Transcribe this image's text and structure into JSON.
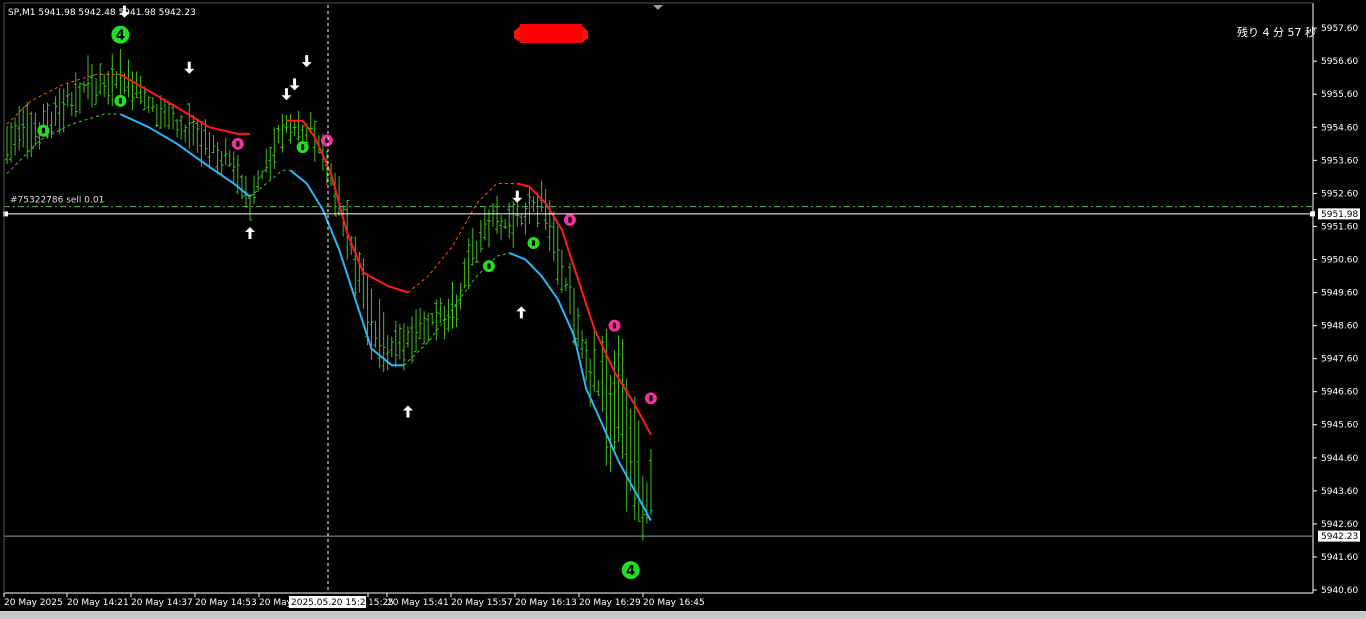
{
  "window": {
    "symbol_info": "SP,M1  5941.98 5942.48 5941.98 5942.23",
    "countdown": "残り 4 分 57 秒",
    "order_label": "#75322786 sell 0.01",
    "crosshair_time": "2025.05.20 15:26"
  },
  "colors": {
    "background": "#000000",
    "bars": "#3fbf1f",
    "upper_line": "#ff1a1a",
    "lower_line": "#29b6f6",
    "order_line": "#33cc33",
    "circle_green": "#22dd22",
    "circle_pink": "#ee3399",
    "arrows": "#ffffff"
  },
  "chart_data": {
    "type": "line",
    "xlabel": "",
    "ylabel": "",
    "ylim": [
      5940.6,
      5958.3
    ],
    "yticks": [
      "5957.60",
      "5956.60",
      "5955.60",
      "5954.60",
      "5953.60",
      "5952.60",
      "5951.60",
      "5950.60",
      "5949.60",
      "5948.60",
      "5947.60",
      "5946.60",
      "5945.60",
      "5944.60",
      "5943.60",
      "5942.60",
      "5941.60",
      "5940.60"
    ],
    "xticks": [
      "20 May 2025",
      "20 May 14:21",
      "20 May 14:37",
      "20 May 14:53",
      "20 May",
      "15:25",
      "20 May 15:41",
      "20 May 15:57",
      "20 May 16:13",
      "20 May 16:29",
      "20 May 16:45"
    ],
    "current_price": "5942.23",
    "order_price": "5951.98",
    "order_level": 5952.2,
    "bar_count": 160,
    "bar_ranges_keypoints": [
      [
        0,
        5953.0,
        5955.2
      ],
      [
        10,
        5954.0,
        5955.6
      ],
      [
        20,
        5955.0,
        5956.8
      ],
      [
        28,
        5955.3,
        5957.0
      ],
      [
        35,
        5954.8,
        5955.9
      ],
      [
        45,
        5953.6,
        5955.4
      ],
      [
        55,
        5952.8,
        5954.3
      ],
      [
        60,
        5951.7,
        5953.0
      ],
      [
        68,
        5953.6,
        5955.5
      ],
      [
        75,
        5953.8,
        5955.3
      ],
      [
        80,
        5952.4,
        5954.0
      ],
      [
        90,
        5947.5,
        5950.0
      ],
      [
        95,
        5946.8,
        5948.9
      ],
      [
        102,
        5947.6,
        5949.4
      ],
      [
        110,
        5948.2,
        5950.0
      ],
      [
        118,
        5951.0,
        5952.5
      ],
      [
        125,
        5950.6,
        5952.6
      ],
      [
        132,
        5951.7,
        5953.3
      ],
      [
        138,
        5948.8,
        5951.0
      ],
      [
        145,
        5945.0,
        5948.6
      ],
      [
        150,
        5943.6,
        5949.2
      ],
      [
        155,
        5942.1,
        5946.7
      ],
      [
        159,
        5941.2,
        5945.0
      ]
    ],
    "series": [
      {
        "style": "solid",
        "color": "#ff1a1a",
        "points": [
          [
            28,
            5956.2
          ],
          [
            35,
            5955.7
          ],
          [
            42,
            5955.2
          ],
          [
            50,
            5954.6
          ],
          [
            57,
            5954.4
          ],
          [
            60,
            5954.4
          ]
        ]
      },
      {
        "style": "solid",
        "color": "#ff1a1a",
        "points": [
          [
            69,
            5954.8
          ],
          [
            73,
            5954.8
          ],
          [
            76,
            5954.3
          ],
          [
            80,
            5953.2
          ],
          [
            84,
            5951.4
          ],
          [
            88,
            5950.2
          ],
          [
            94,
            5949.8
          ],
          [
            99,
            5949.6
          ]
        ]
      },
      {
        "style": "solid",
        "color": "#ff1a1a",
        "points": [
          [
            126,
            5952.9
          ],
          [
            129,
            5952.8
          ],
          [
            133,
            5952.3
          ],
          [
            137,
            5951.5
          ],
          [
            141,
            5950.0
          ],
          [
            145,
            5948.5
          ],
          [
            150,
            5947.2
          ],
          [
            155,
            5946.2
          ],
          [
            159,
            5945.3
          ]
        ]
      },
      {
        "style": "dashed",
        "color": "#ff5522",
        "points": [
          [
            0,
            5954.7
          ],
          [
            6,
            5955.4
          ],
          [
            14,
            5955.9
          ],
          [
            22,
            5956.2
          ],
          [
            28,
            5956.2
          ]
        ]
      },
      {
        "style": "dashed",
        "color": "#ff5522",
        "points": [
          [
            99,
            5949.6
          ],
          [
            104,
            5950.1
          ],
          [
            110,
            5951.0
          ],
          [
            116,
            5952.3
          ],
          [
            121,
            5952.9
          ],
          [
            126,
            5952.9
          ]
        ]
      },
      {
        "style": "solid",
        "color": "#29b6f6",
        "points": [
          [
            28,
            5955.0
          ],
          [
            35,
            5954.6
          ],
          [
            42,
            5954.1
          ],
          [
            50,
            5953.4
          ],
          [
            56,
            5952.9
          ],
          [
            60,
            5952.5
          ]
        ]
      },
      {
        "style": "solid",
        "color": "#29b6f6",
        "points": [
          [
            70,
            5953.3
          ],
          [
            74,
            5952.9
          ],
          [
            78,
            5952.1
          ],
          [
            82,
            5950.9
          ],
          [
            86,
            5949.4
          ],
          [
            90,
            5947.9
          ],
          [
            95,
            5947.4
          ],
          [
            98,
            5947.4
          ]
        ]
      },
      {
        "style": "solid",
        "color": "#29b6f6",
        "points": [
          [
            124,
            5950.8
          ],
          [
            128,
            5950.6
          ],
          [
            132,
            5950.1
          ],
          [
            136,
            5949.4
          ],
          [
            140,
            5948.3
          ],
          [
            143,
            5946.7
          ],
          [
            147,
            5945.6
          ],
          [
            151,
            5944.5
          ],
          [
            155,
            5943.6
          ],
          [
            159,
            5942.7
          ]
        ]
      },
      {
        "style": "dashed",
        "color": "#33cc33",
        "points": [
          [
            0,
            5953.2
          ],
          [
            8,
            5954.2
          ],
          [
            16,
            5954.7
          ],
          [
            24,
            5955.0
          ],
          [
            28,
            5955.0
          ]
        ]
      },
      {
        "style": "dashed",
        "color": "#33cc33",
        "points": [
          [
            60,
            5952.5
          ],
          [
            64,
            5952.9
          ],
          [
            68,
            5953.3
          ],
          [
            70,
            5953.3
          ]
        ]
      },
      {
        "style": "dashed",
        "color": "#33cc33",
        "points": [
          [
            98,
            5947.4
          ],
          [
            104,
            5948.1
          ],
          [
            110,
            5949.1
          ],
          [
            116,
            5950.1
          ],
          [
            121,
            5950.7
          ],
          [
            124,
            5950.8
          ]
        ]
      }
    ],
    "circle_markers": [
      {
        "i": 9,
        "p": 5954.5,
        "color": "#22dd22"
      },
      {
        "i": 28,
        "p": 5955.4,
        "color": "#22dd22"
      },
      {
        "i": 57,
        "p": 5954.1,
        "color": "#ee3399"
      },
      {
        "i": 73,
        "p": 5954.0,
        "color": "#22dd22"
      },
      {
        "i": 79,
        "p": 5954.2,
        "color": "#ee3399"
      },
      {
        "i": 119,
        "p": 5950.4,
        "color": "#22dd22"
      },
      {
        "i": 130,
        "p": 5951.1,
        "color": "#22dd22"
      },
      {
        "i": 139,
        "p": 5951.8,
        "color": "#ee3399"
      },
      {
        "i": 150,
        "p": 5948.6,
        "color": "#ee3399"
      },
      {
        "i": 159,
        "p": 5946.4,
        "color": "#ee3399"
      }
    ],
    "arrow_markers": [
      {
        "i": 29,
        "p": 5958.1,
        "dir": "down"
      },
      {
        "i": 45,
        "p": 5956.4,
        "dir": "down"
      },
      {
        "i": 69,
        "p": 5955.6,
        "dir": "down"
      },
      {
        "i": 71,
        "p": 5955.9,
        "dir": "down"
      },
      {
        "i": 74,
        "p": 5956.6,
        "dir": "down"
      },
      {
        "i": 126,
        "p": 5952.5,
        "dir": "down"
      },
      {
        "i": 60,
        "p": 5951.4,
        "dir": "up"
      },
      {
        "i": 99,
        "p": 5946.0,
        "dir": "up"
      },
      {
        "i": 127,
        "p": 5949.0,
        "dir": "up"
      }
    ],
    "number_badges": [
      {
        "i": 28,
        "p": 5957.4,
        "text": "4"
      },
      {
        "i": 154,
        "p": 5941.2,
        "text": "4"
      }
    ]
  }
}
